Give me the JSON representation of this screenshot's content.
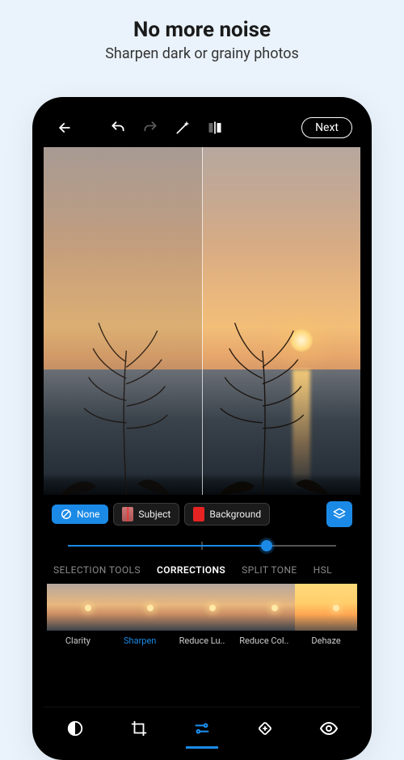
{
  "promo": {
    "title": "No more noise",
    "subtitle": "Sharpen dark or grainy photos"
  },
  "appbar": {
    "next_label": "Next"
  },
  "mask_chips": {
    "none": "None",
    "subject": "Subject",
    "background": "Background"
  },
  "slider": {
    "value_pct": 74
  },
  "tabs": {
    "items": [
      "SELECTION TOOLS",
      "CORRECTIONS",
      "SPLIT TONE",
      "HSL"
    ],
    "active_index": 1
  },
  "corrections": {
    "items": [
      "Clarity",
      "Sharpen",
      "Reduce Lu..",
      "Reduce Col..",
      "Dehaze"
    ],
    "active_index": 1
  },
  "bottom_nav": {
    "items": [
      "looks",
      "crop",
      "adjust",
      "heal",
      "view"
    ],
    "active_index": 2
  }
}
